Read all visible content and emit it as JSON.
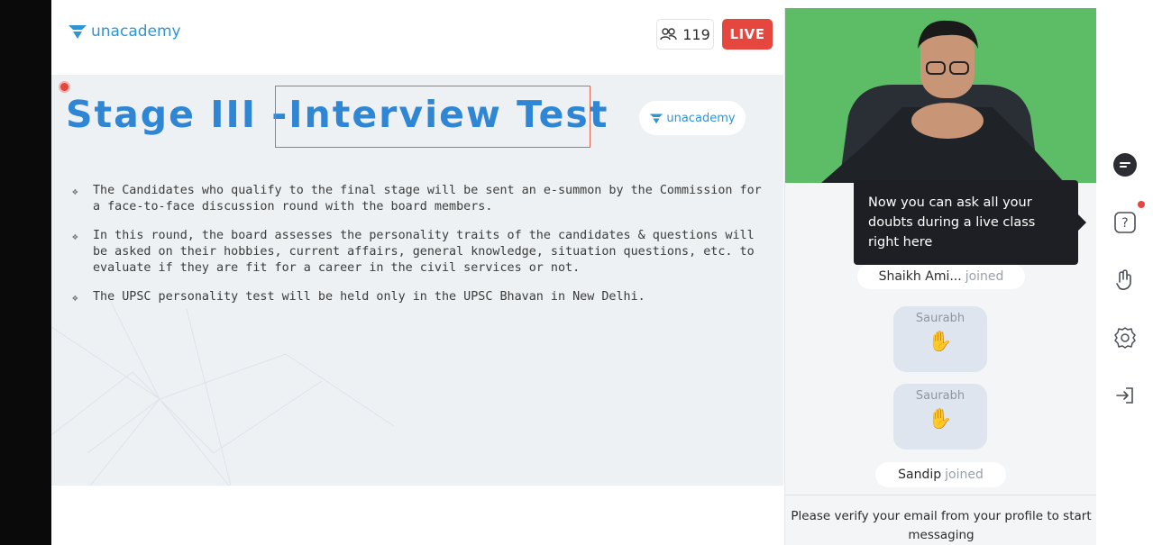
{
  "header": {
    "logo_text": "unacademy",
    "viewer_count": "119",
    "live_label": "LIVE"
  },
  "slide": {
    "title_part1": "Stage III -",
    "title_part2": "Interview Test",
    "logo_text": "unacademy",
    "bullets": [
      "The Candidates who qualify to the final stage will be sent an e-summon by the Commission for a face-to-face discussion round with the board members.",
      "In this round, the board assesses the personality traits of the candidates & questions will be asked on their hobbies, current affairs, general knowledge, situation questions, etc. to evaluate if they are fit for a career in the civil services or not.",
      "The UPSC personality test will be held only in the UPSC Bhavan in New Delhi."
    ]
  },
  "panel": {
    "tooltip": "Now you can ask all your doubts during a live class right here",
    "feed": [
      {
        "type": "join",
        "name": "Shaikh Ami...",
        "suffix": "joined"
      },
      {
        "type": "wave",
        "name": "Saurabh"
      },
      {
        "type": "wave",
        "name": "Saurabh"
      },
      {
        "type": "join",
        "name": "Sandip",
        "suffix": "joined"
      }
    ],
    "verify_text": "Please verify your email from your profile to start messaging"
  },
  "rail": {
    "icons": [
      "chat-icon",
      "doubt-icon",
      "raise-hand-icon",
      "settings-icon",
      "exit-icon"
    ]
  },
  "colors": {
    "brand": "#2e95d2",
    "live": "#e5473f",
    "title": "#2f86d4",
    "video_bg": "#5fbe69",
    "tooltip_bg": "#1d1f24"
  }
}
